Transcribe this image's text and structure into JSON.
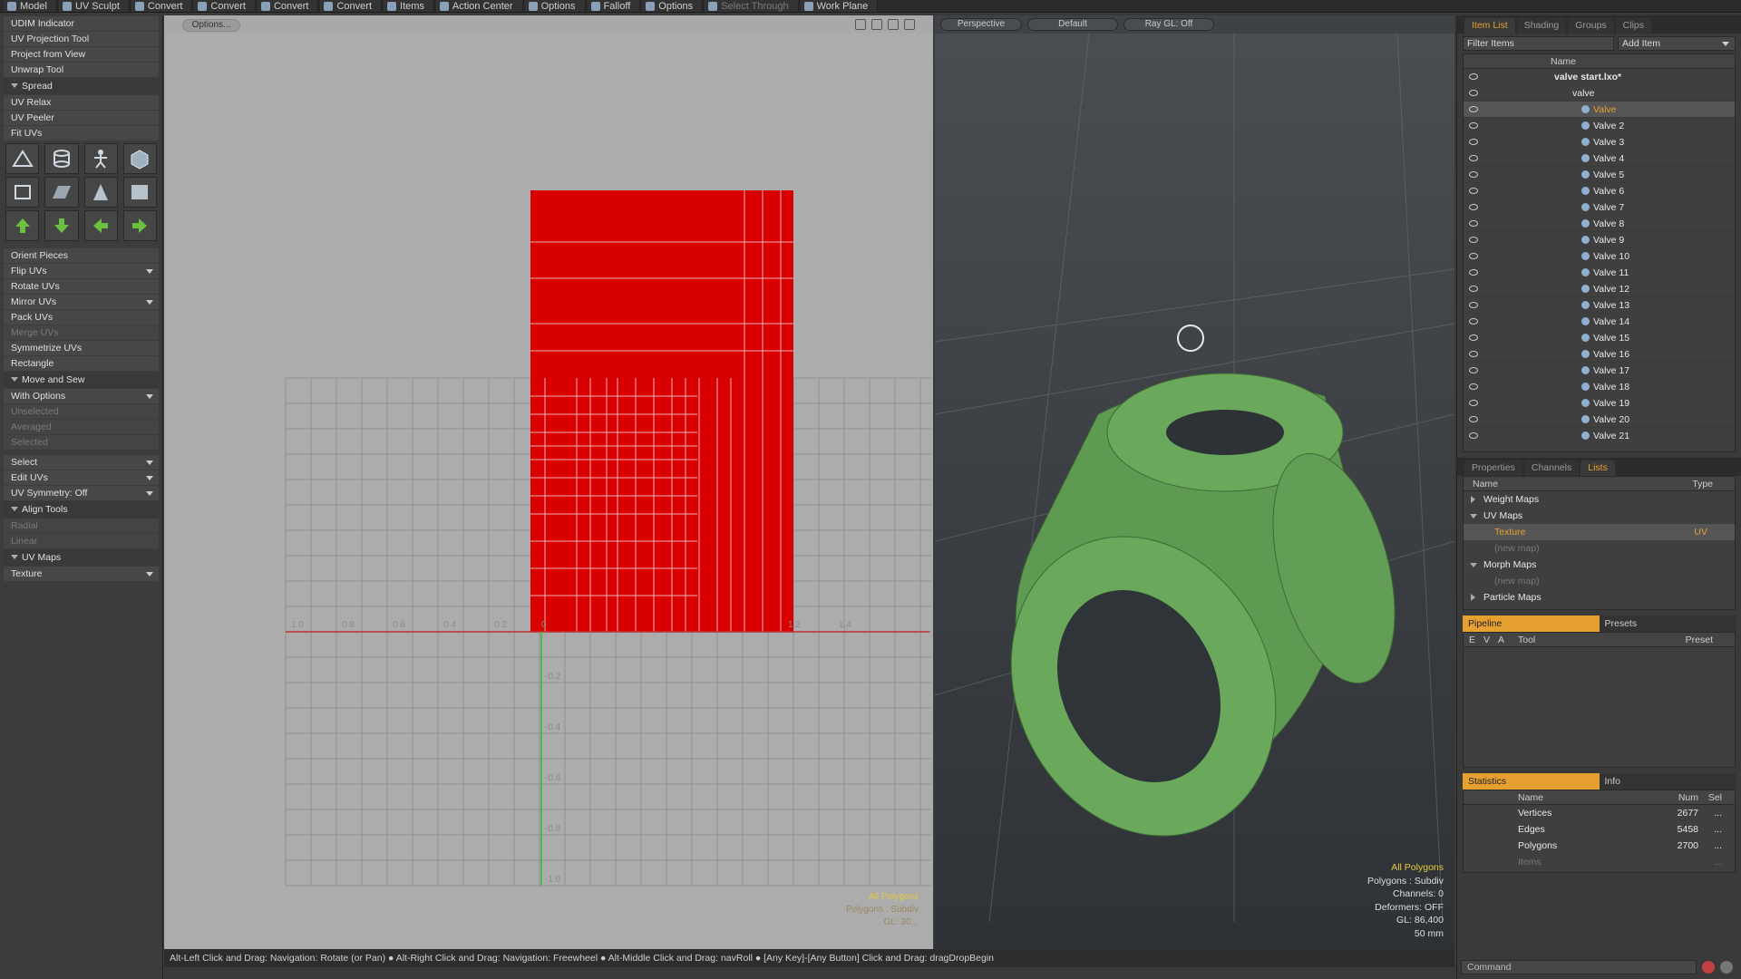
{
  "topbar": [
    {
      "label": "Model",
      "dim": false
    },
    {
      "label": "UV Sculpt",
      "dim": false
    },
    {
      "label": "Convert",
      "dim": false
    },
    {
      "label": "Convert",
      "dim": false
    },
    {
      "label": "Convert",
      "dim": false
    },
    {
      "label": "Convert",
      "dim": false
    },
    {
      "label": "Items",
      "dim": false
    },
    {
      "label": "Action Center",
      "dim": false
    },
    {
      "label": "Options",
      "dim": false
    },
    {
      "label": "Falloff",
      "dim": false
    },
    {
      "label": "Options",
      "dim": false
    },
    {
      "label": "Select Through",
      "dim": true
    },
    {
      "label": "Work Plane",
      "dim": false
    }
  ],
  "left": {
    "top_tools": [
      "UDIM Indicator",
      "UV Projection Tool",
      "Project from View",
      "Unwrap Tool"
    ],
    "spread": "Spread",
    "spread_tools": [
      "UV Relax",
      "UV Peeler",
      "Fit UVs"
    ],
    "orient_tools": [
      "Orient Pieces"
    ],
    "flip": "Flip UVs",
    "rotate": "Rotate UVs",
    "mirror": "Mirror UVs",
    "pack": "Pack UVs",
    "merge": "Merge UVs",
    "symmetrize": "Symmetrize UVs",
    "rectangle": "Rectangle",
    "move_sew": "Move and Sew",
    "with_options": "With Options",
    "unselected": "Unselected",
    "averaged": "Averaged",
    "selected": "Selected",
    "select": "Select",
    "edit_uvs": "Edit UVs",
    "uv_symmetry": "UV Symmetry: Off",
    "align_tools": "Align Tools",
    "radial": "Radial",
    "linear": "Linear",
    "uv_maps": "UV Maps",
    "texture": "Texture"
  },
  "uv": {
    "options": "Options...",
    "ticks_x": [
      "1.0",
      "0.8",
      "0.6",
      "0.4",
      "0.2",
      "0",
      "1.2",
      "1.4"
    ],
    "ticks_y": [
      "-0.2",
      "-0.4",
      "-0.6",
      "-0.8",
      "-1.0"
    ],
    "info_line1": "All Polygons",
    "info_line2": "Polygons : Subdiv",
    "info_line3": "GL: 30..."
  },
  "view3d": {
    "mode": "Perspective",
    "shading": "Default",
    "raygl": "Ray GL: Off",
    "info": [
      "All Polygons",
      "Polygons : Subdiv",
      "Channels: 0",
      "Deformers: OFF",
      "GL: 86,400",
      "50 mm"
    ]
  },
  "status": "Alt-Left Click and Drag: Navigation: Rotate (or Pan) ● Alt-Right Click and Drag: Navigation: Freewheel ● Alt-Middle Click and Drag: navRoll ● [Any Key]-[Any Button] Click and Drag: dragDropBegin",
  "right": {
    "tabs": [
      "Item List",
      "Shading",
      "Groups",
      "Clips"
    ],
    "filter": "Filter Items",
    "add_item": "Add Item",
    "name_col": "Name",
    "scene": "valve start.lxo*",
    "group": "valve",
    "items": [
      "Valve",
      "Valve 2",
      "Valve 3",
      "Valve 4",
      "Valve 5",
      "Valve 6",
      "Valve 7",
      "Valve 8",
      "Valve 9",
      "Valve 10",
      "Valve 11",
      "Valve 12",
      "Valve 13",
      "Valve 14",
      "Valve 15",
      "Valve 16",
      "Valve 17",
      "Valve 18",
      "Valve 19",
      "Valve 20",
      "Valve 21"
    ],
    "tabs2": [
      "Properties",
      "Channels",
      "Lists"
    ],
    "lists_name": "Name",
    "lists_type": "Type",
    "weight_maps": "Weight Maps",
    "uv_maps": "UV Maps",
    "texture": "Texture",
    "texture_type": "UV",
    "new_map": "(new map)",
    "morph_maps": "Morph Maps",
    "new_map2": "(new map)",
    "particle_maps": "Particle Maps",
    "pipeline": "Pipeline",
    "presets": "Presets",
    "pipe_cols": [
      "E",
      "V",
      "A",
      "Tool",
      "Preset"
    ],
    "statistics": "Statistics",
    "info": "Info",
    "stat_name": "Name",
    "stat_num": "Num",
    "stat_sel": "Sel",
    "stats": [
      {
        "name": "Vertices",
        "num": "2677",
        "sel": "..."
      },
      {
        "name": "Edges",
        "num": "5458",
        "sel": "..."
      },
      {
        "name": "Polygons",
        "num": "2700",
        "sel": "..."
      },
      {
        "name": "Items",
        "num": "",
        "sel": "..."
      }
    ],
    "command": "Command"
  }
}
